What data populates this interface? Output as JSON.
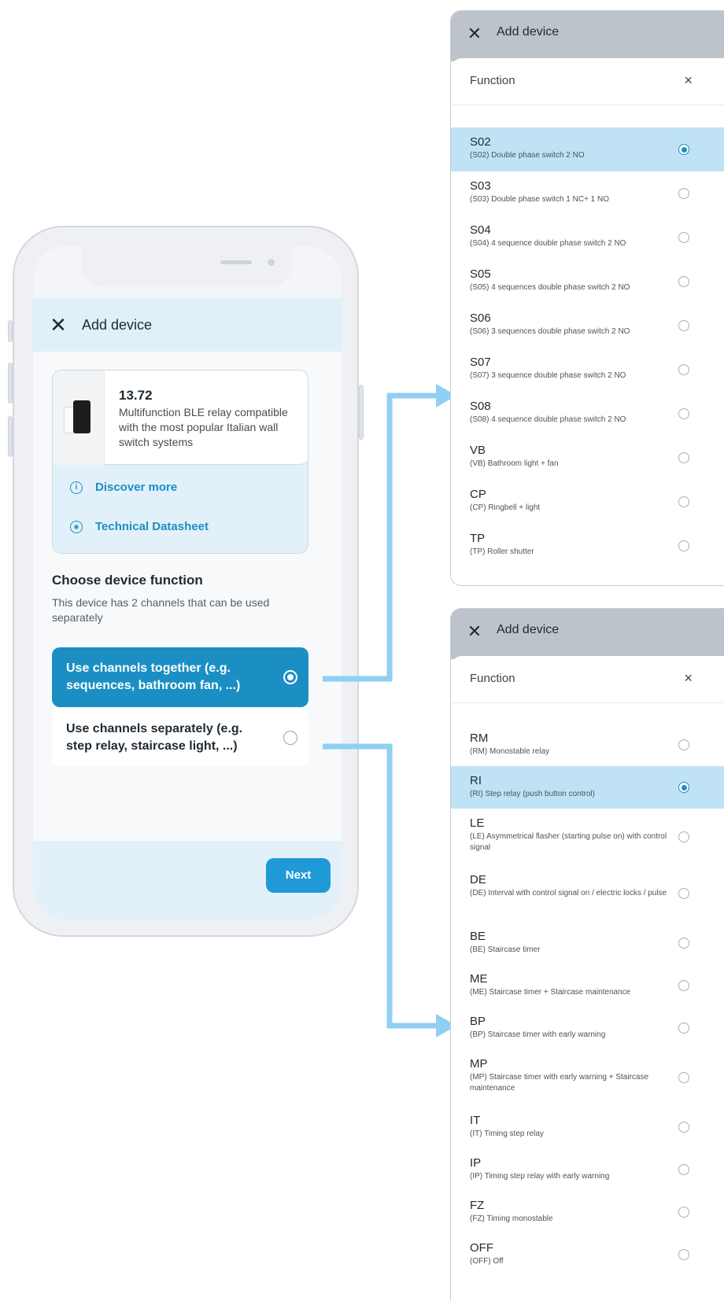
{
  "phone": {
    "header_title": "Add device",
    "product": {
      "name": "13.72",
      "description": "Multifunction BLE relay compatible with the most popular Italian wall switch systems",
      "discover_more": "Discover more",
      "technical_datasheet": "Technical Datasheet"
    },
    "section_title": "Choose device function",
    "section_subtitle": "This device has 2 channels that can be used separately",
    "options": [
      {
        "label": "Use channels together (e.g. sequences, bathroom fan, ...)",
        "selected": true
      },
      {
        "label": "Use channels separately (e.g. step relay, staircase light, ...)",
        "selected": false
      }
    ],
    "next_label": "Next"
  },
  "panel_together": {
    "header_title": "Add device",
    "sheet_title": "Function",
    "close_glyph": "×",
    "items": [
      {
        "code": "S02",
        "desc": "(S02) Double phase switch 2 NO",
        "selected": true
      },
      {
        "code": "S03",
        "desc": "(S03) Double phase switch 1 NC+ 1 NO",
        "selected": false
      },
      {
        "code": "S04",
        "desc": "(S04) 4 sequence double phase switch 2 NO",
        "selected": false
      },
      {
        "code": "S05",
        "desc": "(S05) 4 sequences double phase switch 2 NO",
        "selected": false
      },
      {
        "code": "S06",
        "desc": "(S06) 3 sequences double phase switch 2 NO",
        "selected": false
      },
      {
        "code": "S07",
        "desc": "(S07) 3 sequence double phase switch 2 NO",
        "selected": false
      },
      {
        "code": "S08",
        "desc": "(S08) 4 sequence double phase switch 2 NO",
        "selected": false
      },
      {
        "code": "VB",
        "desc": "(VB) Bathroom light + fan",
        "selected": false
      },
      {
        "code": "CP",
        "desc": "(CP) Ringbell + light",
        "selected": false
      },
      {
        "code": "TP",
        "desc": "(TP) Roller shutter",
        "selected": false
      }
    ]
  },
  "panel_separate": {
    "header_title": "Add device",
    "sheet_title": "Function",
    "close_glyph": "×",
    "items": [
      {
        "code": "RM",
        "desc": "(RM) Monostable relay",
        "selected": false
      },
      {
        "code": "RI",
        "desc": "(RI) Step relay (push button control)",
        "selected": true
      },
      {
        "code": "LE",
        "desc": "(LE) Asymmetrical flasher (starting pulse on) with control signal",
        "selected": false
      },
      {
        "code": "DE",
        "desc": "(DE) Interval with control signal on / electric locks / pulse",
        "selected": false
      },
      {
        "code": "BE",
        "desc": "(BE) Staircase timer",
        "selected": false
      },
      {
        "code": "ME",
        "desc": "(ME) Staircase timer + Staircase maintenance",
        "selected": false
      },
      {
        "code": "BP",
        "desc": "(BP) Staircase timer with early warning",
        "selected": false
      },
      {
        "code": "MP",
        "desc": "(MP) Staircase timer with early warning + Staircase maintenance",
        "selected": false
      },
      {
        "code": "IT",
        "desc": "(IT) Timing step relay",
        "selected": false
      },
      {
        "code": "IP",
        "desc": "(IP) Timing step relay with early warning",
        "selected": false
      },
      {
        "code": "FZ",
        "desc": "(FZ) Timing monostable",
        "selected": false
      },
      {
        "code": "OFF",
        "desc": "(OFF) Off",
        "selected": false
      }
    ]
  },
  "colors": {
    "accent": "#1b8fc4",
    "arrow": "#8fd0f2",
    "selected_row": "#bfe3f4",
    "header_bg": "#dff0f8"
  }
}
